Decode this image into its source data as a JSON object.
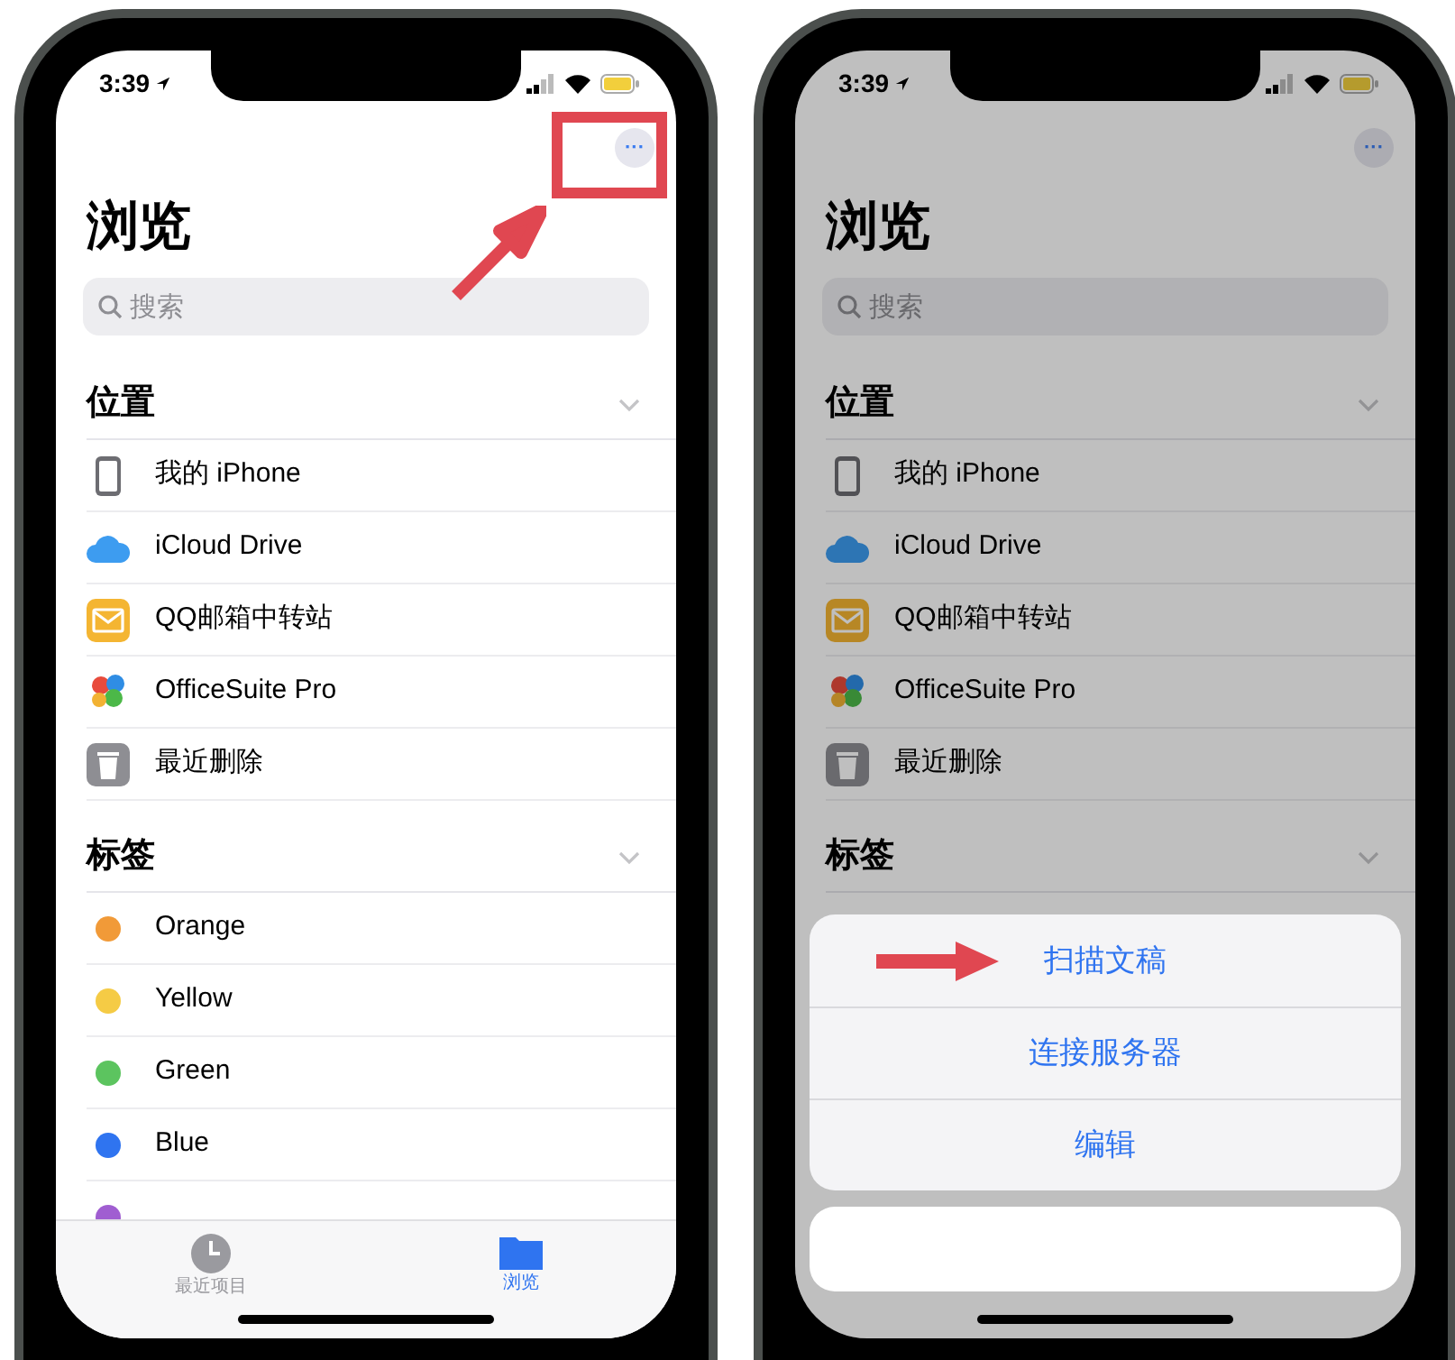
{
  "phones": [
    {
      "dimmed": false,
      "status_bar": {
        "time": "3:39"
      },
      "more_button": {
        "label": "···",
        "highlighted": true
      },
      "title": "浏览",
      "search": {
        "placeholder": "搜索"
      },
      "sections": [
        {
          "title": "位置",
          "expanded": true,
          "items": [
            {
              "kind": "device",
              "label": "我的 iPhone"
            },
            {
              "kind": "cloud",
              "label": "iCloud Drive"
            },
            {
              "kind": "mail",
              "label": "QQ邮箱中转站"
            },
            {
              "kind": "app",
              "label": "OfficeSuite Pro"
            },
            {
              "kind": "trash",
              "label": "最近删除"
            }
          ]
        },
        {
          "title": "标签",
          "expanded": true,
          "items": [
            {
              "kind": "tag",
              "label": "Orange",
              "color": "#f19a38"
            },
            {
              "kind": "tag",
              "label": "Yellow",
              "color": "#f5cb45"
            },
            {
              "kind": "tag",
              "label": "Green",
              "color": "#5cc45f"
            },
            {
              "kind": "tag",
              "label": "Blue",
              "color": "#2f74f0"
            },
            {
              "kind": "tag",
              "color": "#a05ed1"
            }
          ]
        }
      ],
      "tab_bar": [
        {
          "label": "最近项目",
          "kind": "recents",
          "selected": false
        },
        {
          "label": "浏览",
          "kind": "browse",
          "selected": true
        }
      ]
    },
    {
      "dimmed": true,
      "status_bar": {
        "time": "3:39"
      },
      "more_button": {
        "label": "···",
        "highlighted": false
      },
      "title": "浏览",
      "search": {
        "placeholder": "搜索"
      },
      "sections": [
        {
          "title": "位置",
          "expanded": true,
          "items": [
            {
              "kind": "device",
              "label": "我的 iPhone"
            },
            {
              "kind": "cloud",
              "label": "iCloud Drive"
            },
            {
              "kind": "mail",
              "label": "QQ邮箱中转站"
            },
            {
              "kind": "app",
              "label": "OfficeSuite Pro"
            },
            {
              "kind": "trash",
              "label": "最近删除"
            }
          ]
        },
        {
          "title": "标签",
          "expanded": true
        }
      ],
      "action_sheet": {
        "actions": [
          {
            "label": "扫描文稿",
            "highlighted": true
          },
          {
            "label": "连接服务器",
            "highlighted": false
          },
          {
            "label": "编辑",
            "highlighted": false
          }
        ]
      }
    }
  ]
}
